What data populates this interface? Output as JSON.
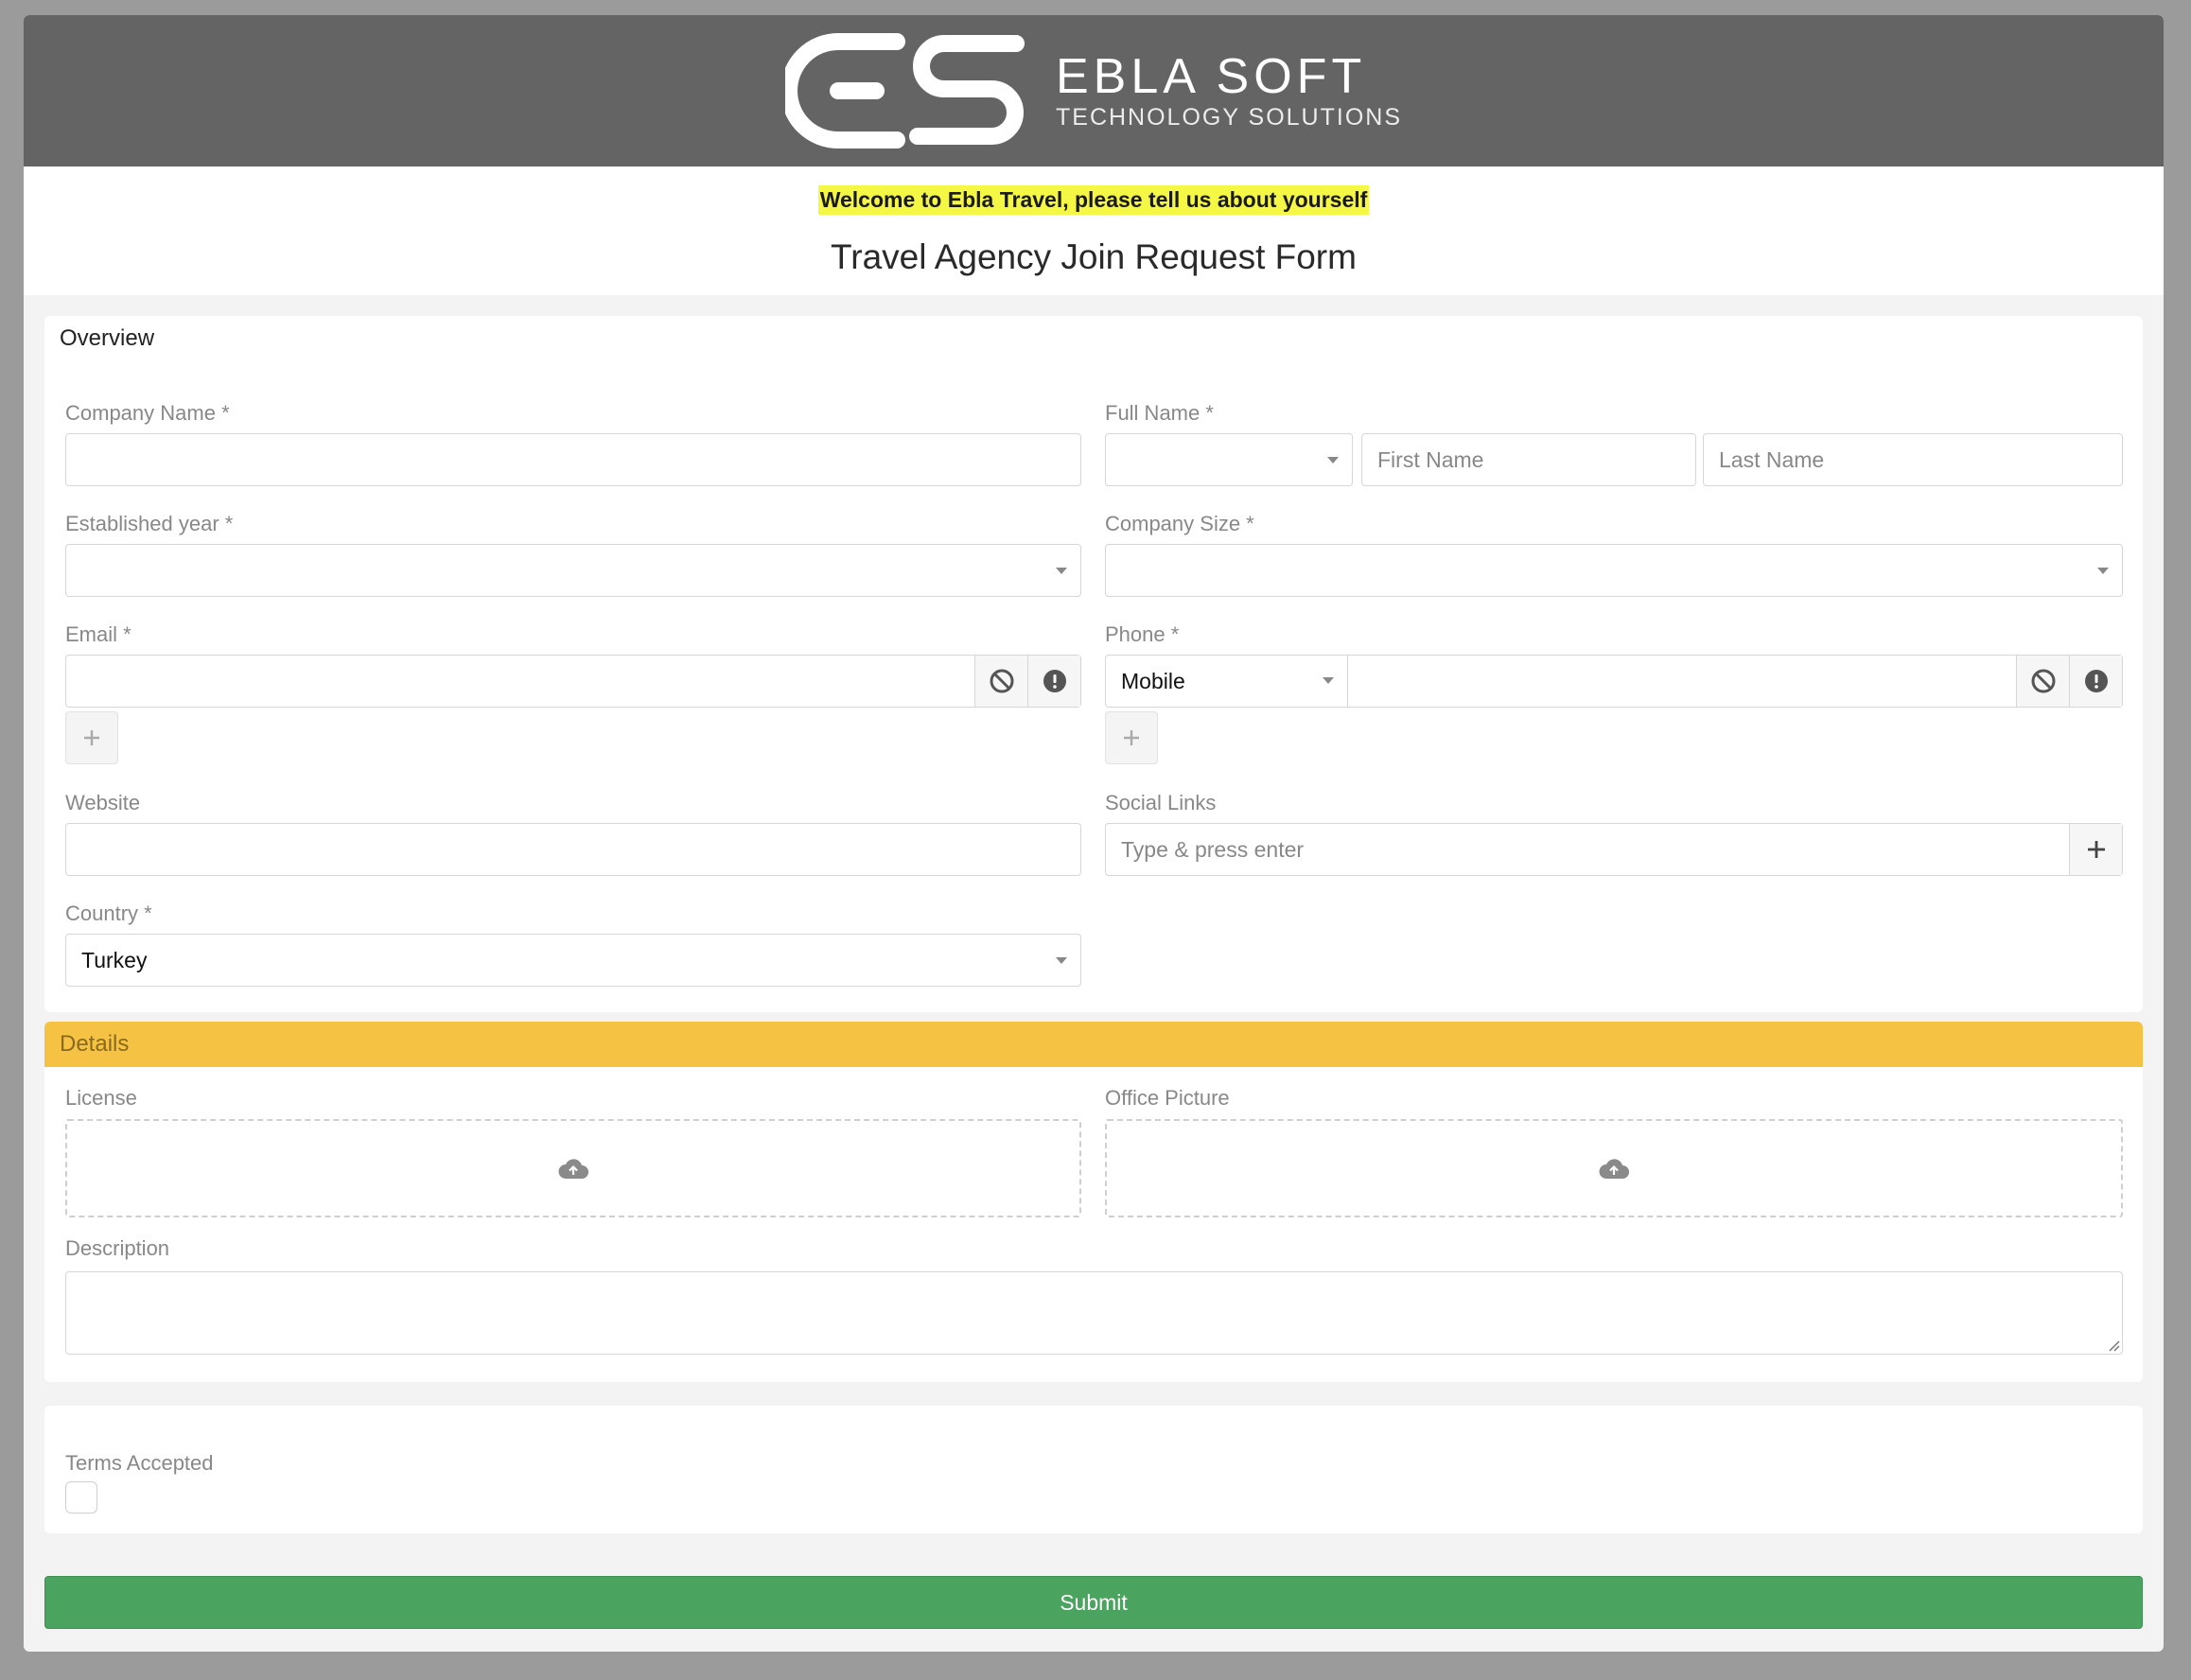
{
  "brand": {
    "name": "EBLA SOFT",
    "tagline": "TECHNOLOGY SOLUTIONS"
  },
  "intro": {
    "welcome": "Welcome to Ebla Travel, please tell us about yourself",
    "title": "Travel Agency Join Request Form"
  },
  "overview": {
    "heading": "Overview",
    "company_name": {
      "label": "Company Name *",
      "value": ""
    },
    "full_name": {
      "label": "Full Name *",
      "title_value": "",
      "first_placeholder": "First Name",
      "last_placeholder": "Last Name"
    },
    "established_year": {
      "label": "Established year *",
      "value": ""
    },
    "company_size": {
      "label": "Company Size *",
      "value": ""
    },
    "email": {
      "label": "Email *",
      "value": ""
    },
    "phone": {
      "label": "Phone *",
      "type_value": "Mobile",
      "value": ""
    },
    "website": {
      "label": "Website",
      "value": ""
    },
    "social_links": {
      "label": "Social Links",
      "placeholder": "Type & press enter"
    },
    "country": {
      "label": "Country *",
      "value": "Turkey"
    }
  },
  "details": {
    "heading": "Details",
    "license": {
      "label": "License"
    },
    "office_picture": {
      "label": "Office Picture"
    },
    "description": {
      "label": "Description",
      "value": ""
    }
  },
  "terms": {
    "label": "Terms Accepted",
    "checked": false
  },
  "submit_label": "Submit",
  "colors": {
    "header_bg": "#646464",
    "highlight": "#f4f744",
    "details_header": "#f5c244",
    "submit": "#4aa35e"
  },
  "icons": {
    "logo": "es-logo-icon",
    "clear": "ban-icon",
    "validation": "exclamation-circle-icon",
    "add": "plus-icon",
    "upload": "cloud-upload-icon",
    "dropdown": "caret-down-icon"
  }
}
